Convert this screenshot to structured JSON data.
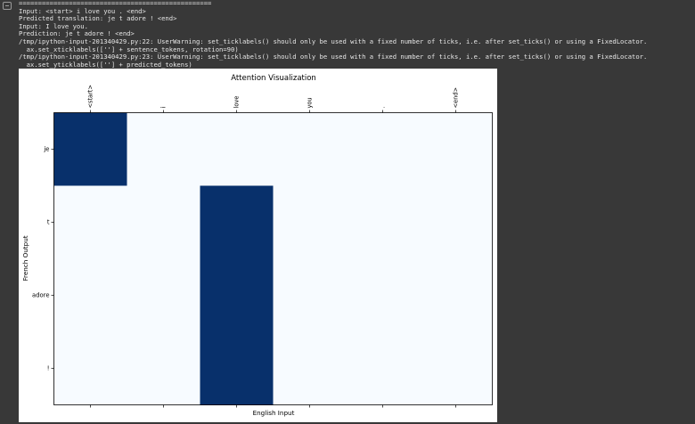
{
  "output": {
    "lines": [
      "==================================================",
      "Input: <start> i love you . <end>",
      "Predicted translation: je t adore ! <end>",
      "Input: I love you.",
      "Prediction: je t adore ! <end>",
      "/tmp/ipython-input-201340429.py:22: UserWarning: set_ticklabels() should only be used with a fixed number of ticks, i.e. after set_ticks() or using a FixedLocator.",
      "  ax.set_xticklabels([''] + sentence_tokens, rotation=90)",
      "/tmp/ipython-input-201340429.py:23: UserWarning: set_ticklabels() should only be used with a fixed number of ticks, i.e. after set_ticks() or using a FixedLocator.",
      "  ax.set_yticklabels([''] + predicted_tokens)"
    ]
  },
  "chart_data": {
    "type": "heatmap",
    "title": "Attention Visualization",
    "xlabel": "English Input",
    "ylabel": "French Output",
    "x_tick_labels": [
      "<start>",
      "i",
      "love",
      "you",
      ".",
      "<end>"
    ],
    "y_tick_labels": [
      "je",
      "t",
      "adore",
      "!"
    ],
    "colormap": "Blues",
    "colors": {
      "low": "#f7fbff",
      "high": "#08306b"
    },
    "values": [
      [
        1,
        0,
        0,
        0,
        0,
        0
      ],
      [
        0,
        0,
        1,
        0,
        0,
        0
      ],
      [
        0,
        0,
        1,
        0,
        0,
        0
      ],
      [
        0,
        0,
        1,
        0,
        0,
        0
      ]
    ]
  }
}
